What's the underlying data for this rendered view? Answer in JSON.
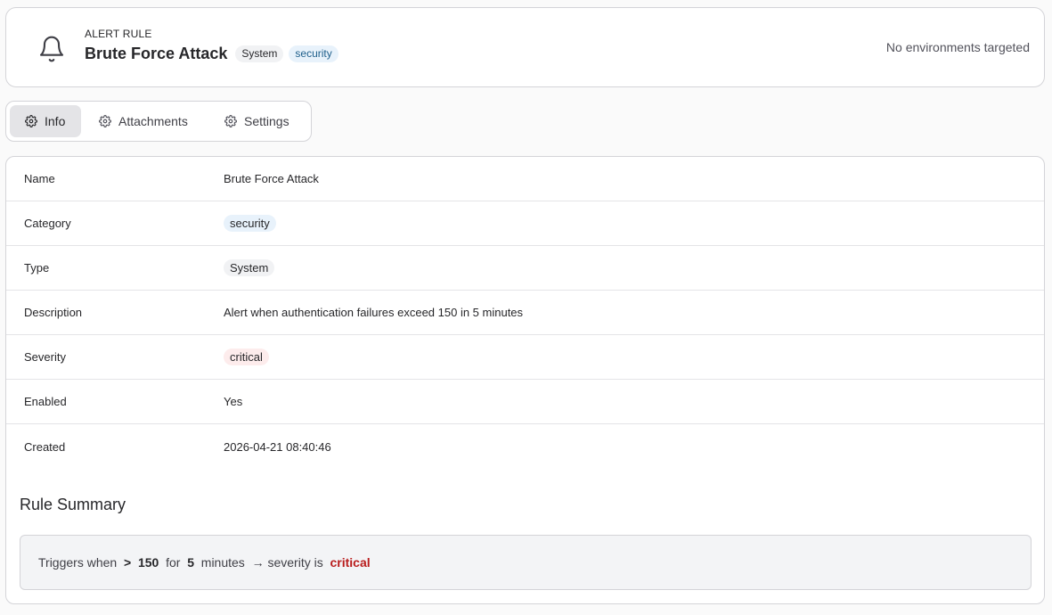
{
  "header": {
    "eyebrow": "ALERT RULE",
    "title": "Brute Force Attack",
    "type_badge": "System",
    "category_badge": "security",
    "environments_note": "No environments targeted",
    "icon": "bell-icon"
  },
  "tabs": [
    {
      "label": "Info",
      "icon": "gear-icon",
      "active": true
    },
    {
      "label": "Attachments",
      "icon": "gear-icon",
      "active": false
    },
    {
      "label": "Settings",
      "icon": "gear-icon",
      "active": false
    }
  ],
  "details": {
    "name": {
      "label": "Name",
      "value": "Brute Force Attack"
    },
    "category": {
      "label": "Category",
      "value": "security"
    },
    "type": {
      "label": "Type",
      "value": "System"
    },
    "description": {
      "label": "Description",
      "value": "Alert when authentication failures exceed 150 in 5 minutes"
    },
    "severity": {
      "label": "Severity",
      "value": "critical"
    },
    "enabled": {
      "label": "Enabled",
      "value": "Yes"
    },
    "created": {
      "label": "Created",
      "value": "2026-04-21 08:40:46"
    }
  },
  "summary": {
    "title": "Rule Summary",
    "prefix": "Triggers when",
    "operator": ">",
    "threshold": "150",
    "for_word": "for",
    "window": "5",
    "unit": "minutes",
    "arrow_text": "→ severity is",
    "severity": "critical"
  },
  "colors": {
    "security_badge_bg": "#e8f2fb",
    "security_badge_fg": "#1f5f8b",
    "critical_fg": "#b91c1c",
    "critical_bg": "#fdecec"
  }
}
